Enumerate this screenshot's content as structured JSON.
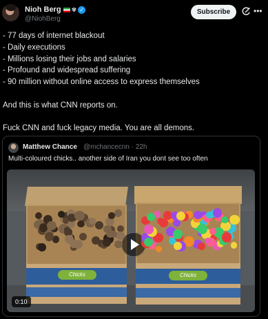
{
  "post": {
    "author_name": "Nioh Berg",
    "author_handle": "@NiohBerg",
    "subscribe_label": "Subscribe",
    "badge": "verified",
    "lines": [
      "- 77 days of internet blackout",
      "- Daily executions",
      "- Millions losing their jobs and salaries",
      "- Profound and widespread suffering",
      "- 90 million without online access to express themselves",
      "",
      "And this is what CNN reports on.",
      "",
      "Fuck CNN and fuck legacy media. You are all demons."
    ]
  },
  "quote": {
    "author_name": "Matthew Chance",
    "author_handle": "@mchancecnn",
    "time": "· 22h",
    "text": "Multi-coloured chicks.. another side of Iran you dont see too often",
    "video_duration": "0:10",
    "box_label": "Chicks"
  },
  "icons": {
    "grok": "grok-icon",
    "more": "more-icon",
    "play": "play-icon"
  },
  "colors": {
    "background": "#000000",
    "text": "#e7e9ea",
    "muted": "#71767b",
    "verified": "#1d9bf0",
    "border": "#2f3336"
  }
}
